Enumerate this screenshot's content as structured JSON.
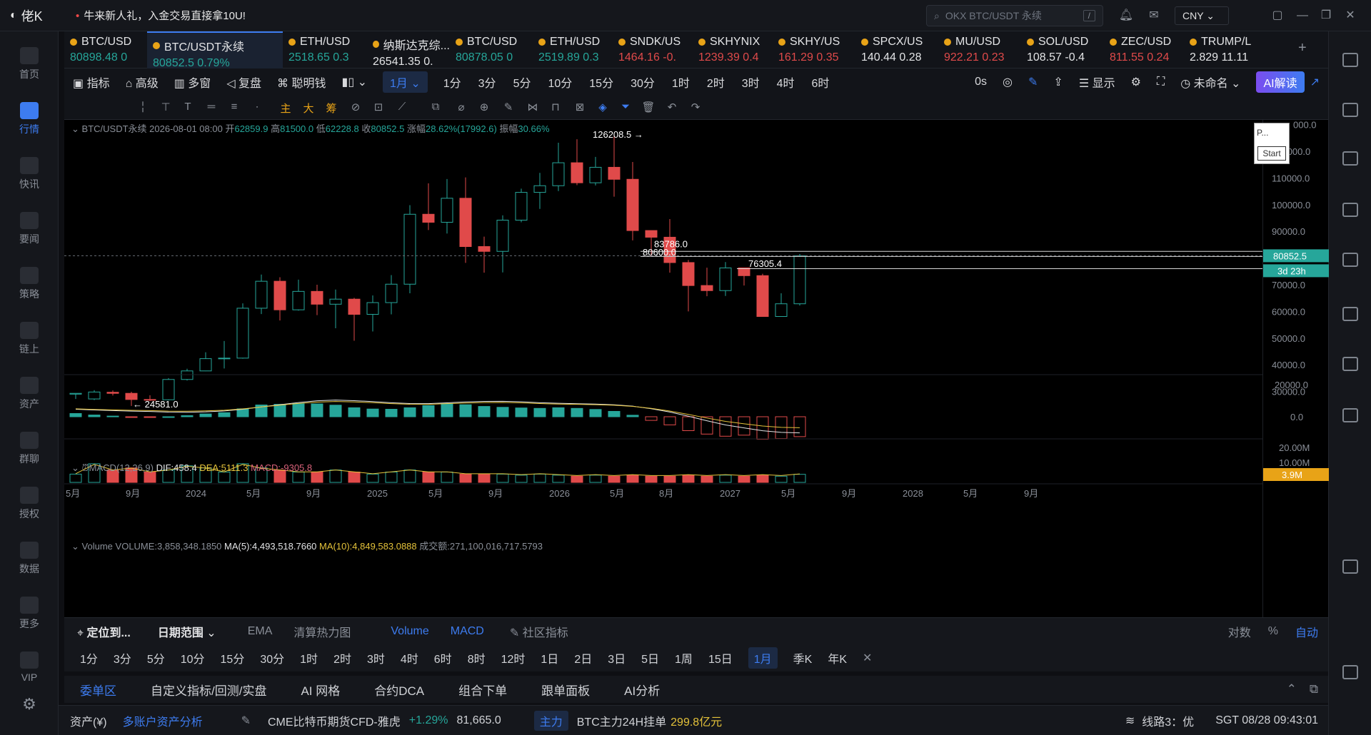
{
  "app": {
    "name": "佬K",
    "promo": "牛来新人礼，入金交易直接拿10U!",
    "search_placeholder": "OKX BTC/USDT 永续",
    "search_shortcut": "/",
    "currency": "CNY"
  },
  "sidebar": [
    {
      "label": "首页"
    },
    {
      "label": "行情",
      "active": true
    },
    {
      "label": "快讯"
    },
    {
      "label": "要闻"
    },
    {
      "label": "策略"
    },
    {
      "label": "链上"
    },
    {
      "label": "资产"
    },
    {
      "label": "群聊"
    },
    {
      "label": "授权"
    },
    {
      "label": "数据"
    },
    {
      "label": "更多"
    },
    {
      "label": "VIP"
    }
  ],
  "tickers": [
    {
      "name": "BTC/USD",
      "price": "80898.48",
      "chg": "0",
      "dir": "up"
    },
    {
      "name": "BTC/USDT永续",
      "price": "80852.5",
      "chg": "0.79%",
      "dir": "up",
      "active": true
    },
    {
      "name": "ETH/USD",
      "price": "2518.65",
      "chg": "0.3",
      "dir": "up"
    },
    {
      "name": "纳斯达克综...",
      "price": "26541.35",
      "chg": "0.",
      "dir": "wh"
    },
    {
      "name": "BTC/USD",
      "price": "80878.05",
      "chg": "0",
      "dir": "up"
    },
    {
      "name": "ETH/USD",
      "price": "2519.89",
      "chg": "0.3",
      "dir": "up"
    },
    {
      "name": "SNDK/US",
      "price": "1464.16",
      "chg": "-0.",
      "dir": "dn"
    },
    {
      "name": "SKHYNIX",
      "price": "1239.39",
      "chg": "0.4",
      "dir": "dn"
    },
    {
      "name": "SKHY/US",
      "price": "161.29",
      "chg": "0.35",
      "dir": "dn"
    },
    {
      "name": "SPCX/US",
      "price": "140.44",
      "chg": "0.28",
      "dir": "wh"
    },
    {
      "name": "MU/USD",
      "price": "922.21",
      "chg": "0.23",
      "dir": "dn"
    },
    {
      "name": "SOL/USD",
      "price": "108.57",
      "chg": "-0.4",
      "dir": "wh"
    },
    {
      "name": "ZEC/USD",
      "price": "811.55",
      "chg": "0.24",
      "dir": "dn"
    },
    {
      "name": "TRUMP/L",
      "price": "2.829",
      "chg": "11.11",
      "dir": "wh"
    }
  ],
  "toolbar": {
    "indicator": "指标",
    "advanced": "高级",
    "multiwin": "多窗",
    "replay": "复盘",
    "smart": "聪明钱",
    "interval": "1月",
    "intervals": [
      "1分",
      "3分",
      "5分",
      "10分",
      "15分",
      "30分",
      "1时",
      "2时",
      "3时",
      "4时",
      "6时"
    ],
    "timer": "0s",
    "display": "显示",
    "unnamed": "未命名",
    "ai": "AI解读"
  },
  "legend": {
    "symbol": "BTC/USDT永续",
    "date": "2026-08-01 08:00",
    "open_l": "开",
    "open": "62859.9",
    "high_l": "高",
    "high": "81500.0",
    "low_l": "低",
    "low": "62228.8",
    "close_l": "收",
    "close": "80852.5",
    "chg_l": "涨幅",
    "chg": "28.62%(17992.6)",
    "amp_l": "振幅",
    "amp": "30.66%"
  },
  "macd": {
    "label": "MACD(12,26,9)",
    "dif": "DIF:458.4",
    "dea": "DEA:5111.3",
    "macd": "MACD:-9305.8"
  },
  "volume": {
    "label": "Volume",
    "vol": "VOLUME:3,858,348.1850",
    "ma5": "MA(5):4,493,518.7660",
    "ma10": "MA(10):4,849,583.0888",
    "amount": "成交额:271,100,016,717.5793"
  },
  "chart_data": {
    "type": "candlestick",
    "ylim": [
      20000,
      130000
    ],
    "yticks": [
      "120000.0",
      "110000.0",
      "100000.0",
      "90000.0",
      "80000.0",
      "70000.0",
      "60000.0",
      "50000.0",
      "40000.0",
      "30000.0"
    ],
    "xticks": [
      "5月",
      "9月",
      "2024",
      "5月",
      "9月",
      "2025",
      "5月",
      "9月",
      "2026",
      "5月",
      "8月",
      "2027",
      "5月",
      "9月",
      "2028",
      "5月",
      "9月"
    ],
    "annotations": [
      "126208.5",
      "24581.0",
      "83786.0",
      "80600.0",
      "76305.4"
    ],
    "last_price": "80852.5",
    "countdown": "3d 23h",
    "macd_ticks": [
      "20000.0",
      "0.0"
    ],
    "vol_ticks": [
      "20.00M",
      "10.00M"
    ],
    "vol_last": "3.9M",
    "candles": [
      [
        29000,
        29300,
        28800,
        27200
      ],
      [
        27200,
        29800,
        30500,
        26800
      ],
      [
        29700,
        29300,
        30400,
        28500
      ],
      [
        29300,
        27000,
        29900,
        24581
      ],
      [
        27000,
        26900,
        28600,
        26400
      ],
      [
        26900,
        34500,
        35000,
        26700
      ],
      [
        34500,
        37700,
        38500,
        34100
      ],
      [
        37700,
        42300,
        44700,
        37600
      ],
      [
        42300,
        42500,
        48900,
        38600
      ],
      [
        42500,
        61200,
        63000,
        42300
      ],
      [
        61200,
        71300,
        73800,
        59000
      ],
      [
        71300,
        60600,
        72800,
        56600
      ],
      [
        60600,
        67500,
        71900,
        60300
      ],
      [
        67500,
        62700,
        70000,
        58600
      ],
      [
        62700,
        64600,
        68200,
        53700
      ],
      [
        64600,
        58900,
        65100,
        49000
      ],
      [
        58900,
        63300,
        66000,
        52500
      ],
      [
        63300,
        70200,
        73600,
        58900
      ],
      [
        70200,
        96400,
        99800,
        66800
      ],
      [
        96400,
        93400,
        108000,
        90500
      ],
      [
        93400,
        102400,
        109600,
        89200
      ],
      [
        102400,
        84300,
        110200,
        78200
      ],
      [
        84300,
        82500,
        88000,
        74500
      ],
      [
        82500,
        94200,
        96000,
        74600
      ],
      [
        94200,
        104600,
        106000,
        93400
      ],
      [
        104600,
        107100,
        111900,
        98400
      ],
      [
        107100,
        115700,
        123200,
        105100
      ],
      [
        115700,
        108200,
        124500,
        107300
      ],
      [
        108200,
        114000,
        117900,
        107200
      ],
      [
        114000,
        109500,
        126208,
        103000
      ],
      [
        109500,
        90300,
        116000,
        86600
      ],
      [
        90300,
        87800,
        83786,
        80600
      ],
      [
        87800,
        78300,
        94600,
        74500
      ],
      [
        78300,
        69700,
        79300,
        60000
      ],
      [
        69700,
        67800,
        76400,
        65700
      ],
      [
        67800,
        76300,
        78500,
        65800
      ],
      [
        76300,
        73400,
        76305,
        69700
      ],
      [
        73400,
        58100,
        74100,
        58100
      ],
      [
        58100,
        62860,
        66800,
        58000
      ],
      [
        62860,
        80852,
        81500,
        62228
      ]
    ],
    "macd_hist": [
      1500,
      800,
      300,
      -100,
      -200,
      0,
      500,
      1300,
      1900,
      3700,
      5500,
      5800,
      6200,
      6000,
      5400,
      4200,
      3600,
      3500,
      4200,
      5200,
      6100,
      5600,
      4800,
      4400,
      4100,
      3900,
      4200,
      3900,
      3400,
      2500,
      700,
      -1700,
      -3800,
      -6500,
      -8100,
      -9100,
      -8600,
      -10500,
      -10200,
      -9300
    ],
    "vol": [
      4,
      9,
      6,
      7,
      5,
      6,
      8,
      7,
      5,
      9,
      7,
      6,
      5,
      5,
      6,
      5,
      4,
      5,
      6,
      5,
      5,
      4,
      4,
      4,
      3.5,
      4,
      3.5,
      3,
      3.5,
      3,
      3.5,
      3,
      3,
      3.5,
      3,
      3.5,
      3,
      3.5,
      3,
      3.9
    ]
  },
  "bottom_tabs": {
    "locate": "定位到...",
    "daterange": "日期范围",
    "indicators": [
      "EMA",
      "清算热力图",
      "Volume",
      "MACD"
    ],
    "community": "社区指标",
    "log": "对数",
    "pct": "%",
    "auto": "自动"
  },
  "bottom_intervals": [
    "1分",
    "3分",
    "5分",
    "10分",
    "15分",
    "30分",
    "1时",
    "2时",
    "3时",
    "4时",
    "6时",
    "8时",
    "12时",
    "1日",
    "2日",
    "3日",
    "5日",
    "1周",
    "15日",
    "1月",
    "季K",
    "年K"
  ],
  "bottom_interval_selected": "1月",
  "panel_tabs": [
    "委单区",
    "自定义指标/回测/实盘",
    "AI 网格",
    "合约DCA",
    "组合下单",
    "跟单面板",
    "AI分析"
  ],
  "status": {
    "asset": "资产(¥)",
    "multi": "多账户资产分析",
    "cme": "CME比特币期货CFD-雅虎",
    "cme_chg": "+1.29%",
    "cme_price": "81,665.0",
    "main_tag": "主力",
    "btc_main": "BTC主力24H挂单",
    "btc_amt": "299.8亿元",
    "line": "线路3：优",
    "time": "SGT 08/28 09:43:01"
  },
  "popup": {
    "title": "P...",
    "btn": "Start"
  }
}
